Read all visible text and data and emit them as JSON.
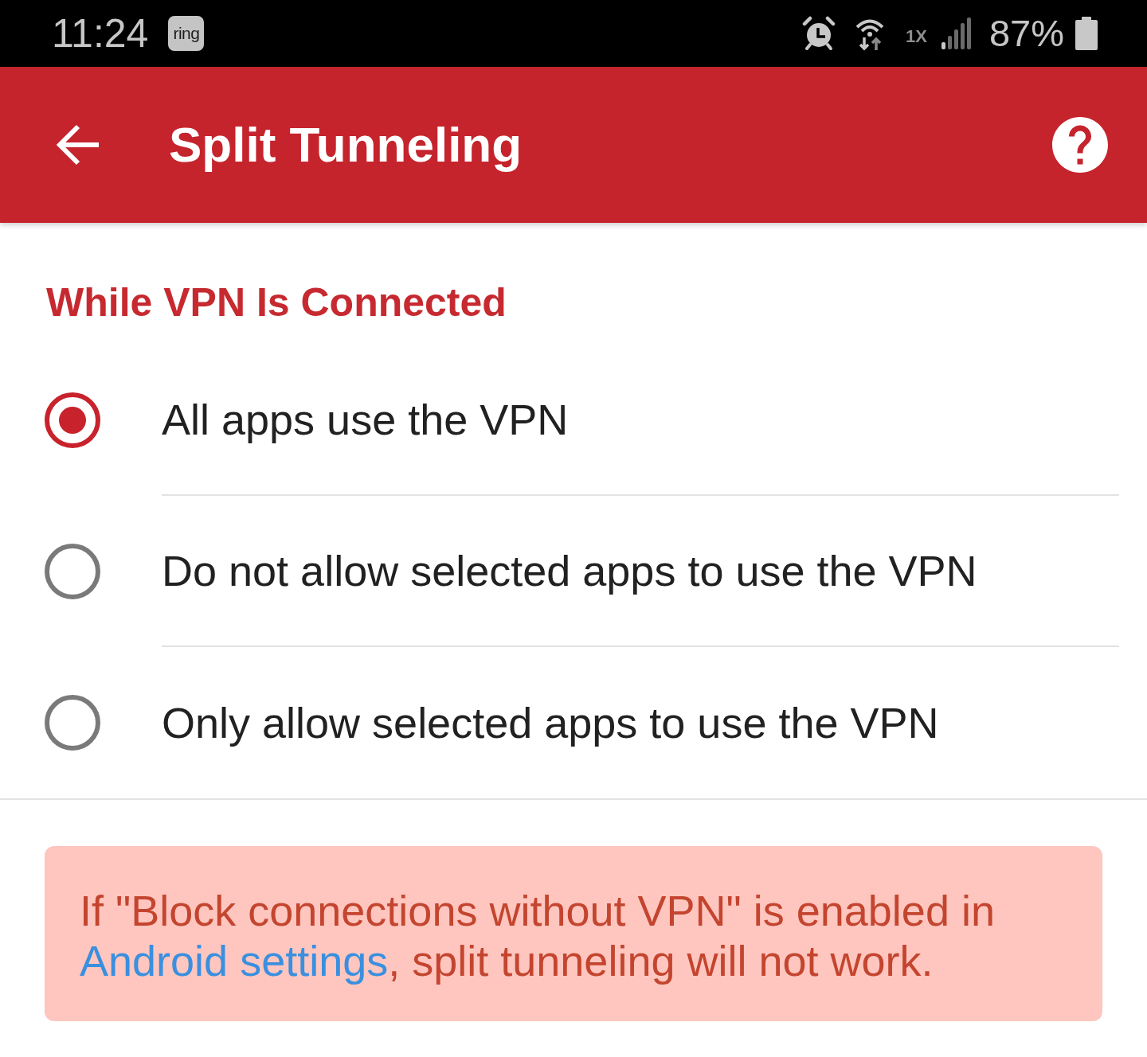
{
  "status_bar": {
    "time": "11:24",
    "notification_badge": "ring",
    "network_label": "1X",
    "battery": "87%"
  },
  "app_bar": {
    "title": "Split Tunneling"
  },
  "section": {
    "heading": "While VPN Is Connected",
    "options": [
      {
        "label": "All apps use the VPN",
        "selected": true
      },
      {
        "label": "Do not allow selected apps to use the VPN",
        "selected": false
      },
      {
        "label": "Only allow selected apps to use the VPN",
        "selected": false
      }
    ]
  },
  "notice": {
    "text_before": "If \"Block connections without VPN\" is enabled in ",
    "link": "Android settings",
    "text_after": ", split tunneling will not work."
  }
}
